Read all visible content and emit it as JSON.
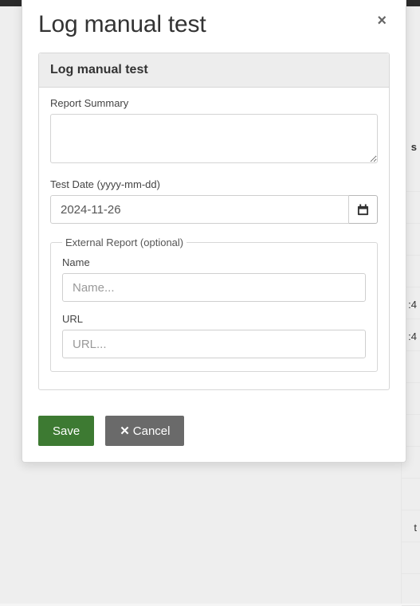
{
  "modal": {
    "title": "Log manual test",
    "close_glyph": "×"
  },
  "panel": {
    "heading": "Log manual test"
  },
  "form": {
    "summary_label": "Report Summary",
    "summary_value": "",
    "date_label": "Test Date (yyyy-mm-dd)",
    "date_value": "2024-11-26",
    "external_legend": "External Report (optional)",
    "name_label": "Name",
    "name_placeholder": "Name...",
    "name_value": "",
    "url_label": "URL",
    "url_placeholder": "URL...",
    "url_value": ""
  },
  "buttons": {
    "save": "Save",
    "cancel_glyph": "✕",
    "cancel": "Cancel"
  },
  "background": {
    "header_fragment": "s",
    "row_fragment_1": ":4",
    "row_fragment_2": ":4",
    "row_fragment_3": "t"
  }
}
